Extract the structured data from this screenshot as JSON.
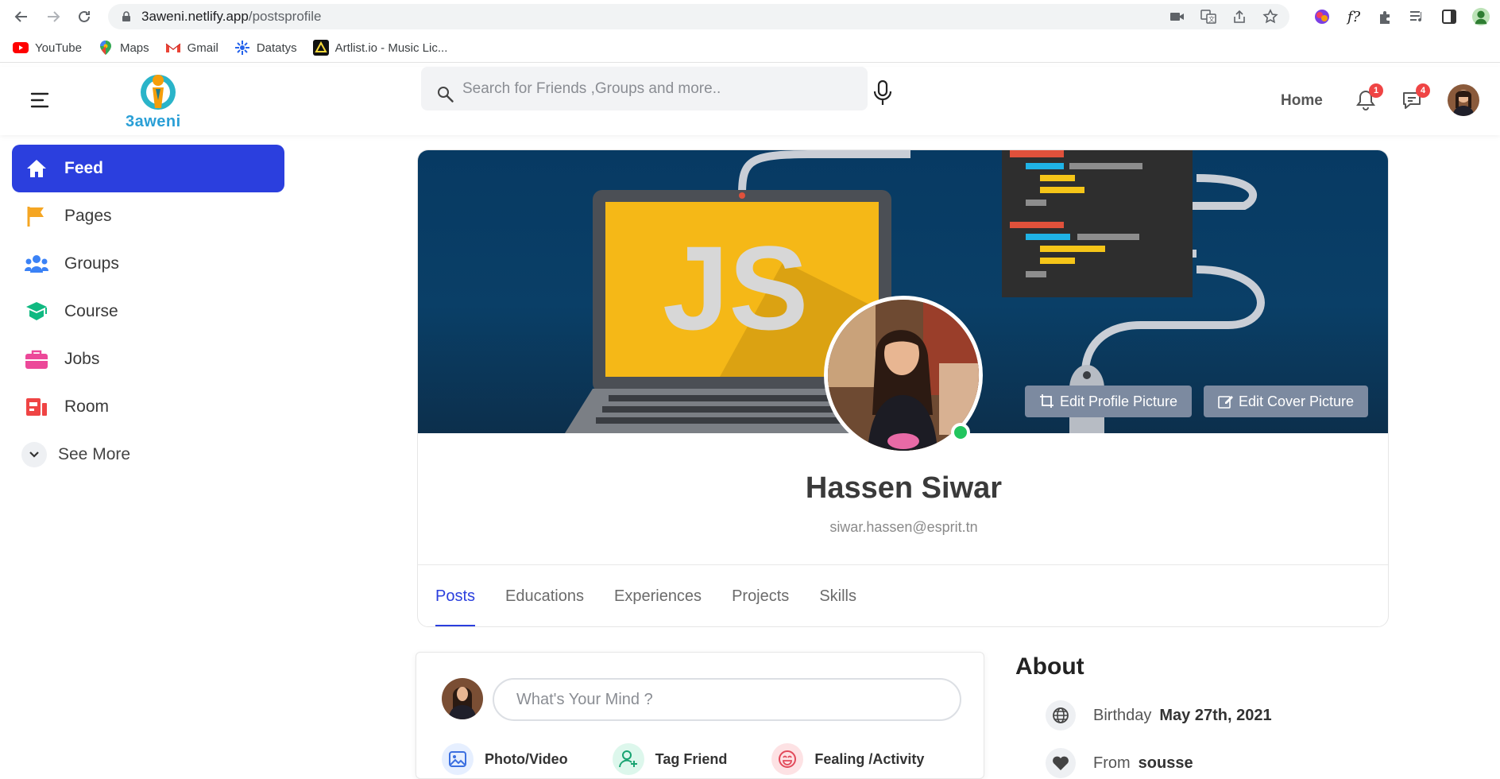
{
  "browser": {
    "url_host": "3aweni.netlify.app",
    "url_path": "/postsprofile",
    "bookmarks": [
      {
        "label": "YouTube",
        "icon": "youtube-icon"
      },
      {
        "label": "Maps",
        "icon": "maps-icon"
      },
      {
        "label": "Gmail",
        "icon": "gmail-icon"
      },
      {
        "label": "Datatys",
        "icon": "datatys-icon"
      },
      {
        "label": "Artlist.io - Music Lic...",
        "icon": "artlist-icon"
      }
    ]
  },
  "header": {
    "logo_text": "3aweni",
    "search_placeholder": "Search for Friends ,Groups and more..",
    "home_label": "Home",
    "notifications_count": "1",
    "messages_count": "4"
  },
  "sidebar": {
    "items": [
      {
        "label": "Feed",
        "icon": "home-icon",
        "color": "#ffffff"
      },
      {
        "label": "Pages",
        "icon": "flag-icon",
        "color": "#f5a623"
      },
      {
        "label": "Groups",
        "icon": "groups-icon",
        "color": "#3b82f6"
      },
      {
        "label": "Course",
        "icon": "graduation-cap-icon",
        "color": "#10b981"
      },
      {
        "label": "Jobs",
        "icon": "briefcase-icon",
        "color": "#ec4899"
      },
      {
        "label": "Room",
        "icon": "room-icon",
        "color": "#ef4444"
      }
    ],
    "see_more": "See More"
  },
  "profile": {
    "name": "Hassen Siwar",
    "email": "siwar.hassen@esprit.tn",
    "edit_profile_picture": "Edit Profile Picture",
    "edit_cover_picture": "Edit Cover Picture",
    "cover_text": "JS",
    "tabs": [
      "Posts",
      "Educations",
      "Experiences",
      "Projects",
      "Skills"
    ],
    "active_tab": "Posts"
  },
  "composer": {
    "placeholder": "What's Your Mind ?",
    "actions": [
      "Photo/Video",
      "Tag Friend",
      "Fealing /Activity"
    ]
  },
  "about": {
    "title": "About",
    "rows": [
      {
        "label": "Birthday",
        "value": "May 27th, 2021",
        "icon": "globe-icon"
      },
      {
        "label": "From",
        "value": "sousse",
        "icon": "heart-icon"
      }
    ]
  },
  "colors": {
    "primary": "#2b3fde",
    "badge": "#ef4444",
    "online": "#22c55e"
  }
}
